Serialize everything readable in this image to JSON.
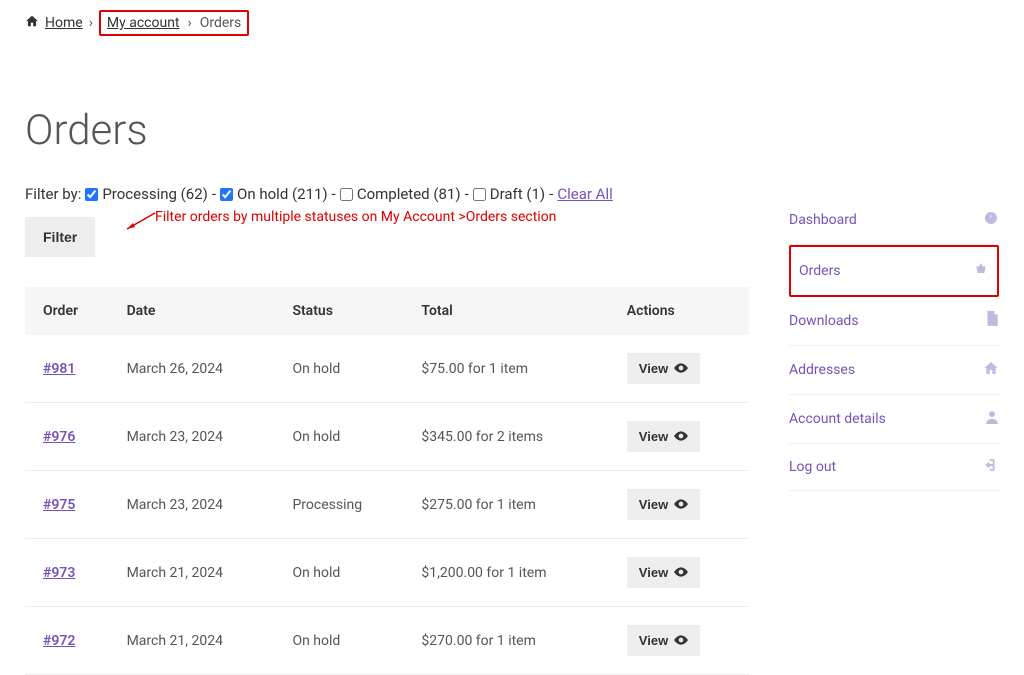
{
  "breadcrumb": {
    "home": "Home",
    "my_account": "My account",
    "orders": "Orders"
  },
  "page_title": "Orders",
  "filter": {
    "label": "Filter by:",
    "options": [
      {
        "label": "Processing (62)",
        "checked": true
      },
      {
        "label": "On hold (211)",
        "checked": true
      },
      {
        "label": "Completed (81)",
        "checked": false
      },
      {
        "label": "Draft (1)",
        "checked": false
      }
    ],
    "clear": "Clear All",
    "button": "Filter"
  },
  "annotation_text": "Filter orders by multiple statuses on My Account >Orders section",
  "table": {
    "headers": {
      "order": "Order",
      "date": "Date",
      "status": "Status",
      "total": "Total",
      "actions": "Actions"
    },
    "rows": [
      {
        "id": "#981",
        "date": "March 26, 2024",
        "status": "On hold",
        "total": "$75.00 for 1 item"
      },
      {
        "id": "#976",
        "date": "March 23, 2024",
        "status": "On hold",
        "total": "$345.00 for 2 items"
      },
      {
        "id": "#975",
        "date": "March 23, 2024",
        "status": "Processing",
        "total": "$275.00 for 1 item"
      },
      {
        "id": "#973",
        "date": "March 21, 2024",
        "status": "On hold",
        "total": "$1,200.00 for 1 item"
      },
      {
        "id": "#972",
        "date": "March 21, 2024",
        "status": "On hold",
        "total": "$270.00 for 1 item"
      }
    ],
    "view_label": "View"
  },
  "sidebar": {
    "items": [
      {
        "label": "Dashboard",
        "icon": "dashboard-icon"
      },
      {
        "label": "Orders",
        "icon": "basket-icon"
      },
      {
        "label": "Downloads",
        "icon": "file-icon"
      },
      {
        "label": "Addresses",
        "icon": "home-icon"
      },
      {
        "label": "Account details",
        "icon": "user-icon"
      },
      {
        "label": "Log out",
        "icon": "logout-icon"
      }
    ]
  }
}
